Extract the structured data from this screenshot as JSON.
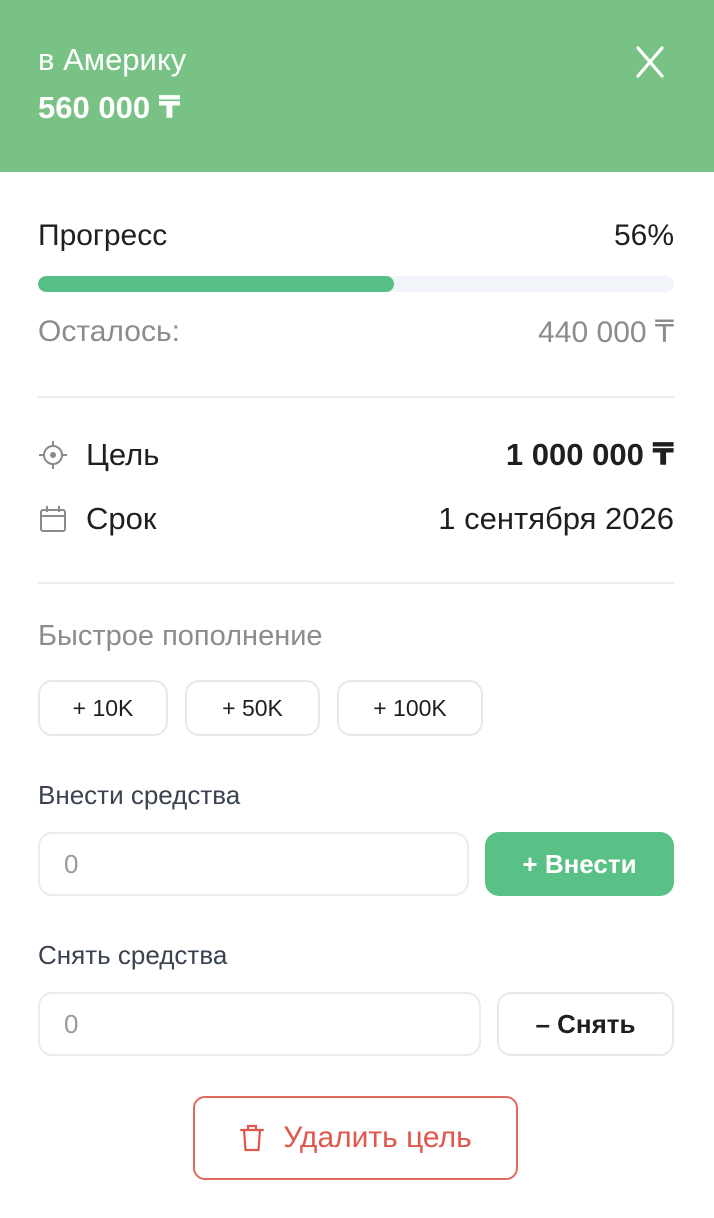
{
  "goal": {
    "name": "в Америку",
    "saved_amount": "560 000 ₸"
  },
  "progress": {
    "label": "Прогресс",
    "percent_text": "56%",
    "fraction": 0.56,
    "remaining_label": "Осталось:",
    "remaining_value": "440 000 ₸"
  },
  "details": {
    "goal_label": "Цель",
    "goal_value": "1 000 000 ₸",
    "deadline_label": "Срок",
    "deadline_value": "1 сентября 2026"
  },
  "quick_topup": {
    "label": "Быстрое пополнение",
    "chips": [
      "+ 10K",
      "+ 50K",
      "+ 100K"
    ]
  },
  "deposit": {
    "label": "Внести средства",
    "placeholder": "0",
    "button": "+ Внести"
  },
  "withdraw": {
    "label": "Снять средства",
    "placeholder": "0",
    "button": "– Снять"
  },
  "delete_button": "Удалить цель",
  "icons": {
    "close": "close-icon",
    "goal": "target-icon",
    "deadline": "calendar-icon",
    "delete": "trash-icon"
  },
  "colors": {
    "header": "#79c285",
    "accent": "#59c185",
    "danger": "#e0574b"
  }
}
